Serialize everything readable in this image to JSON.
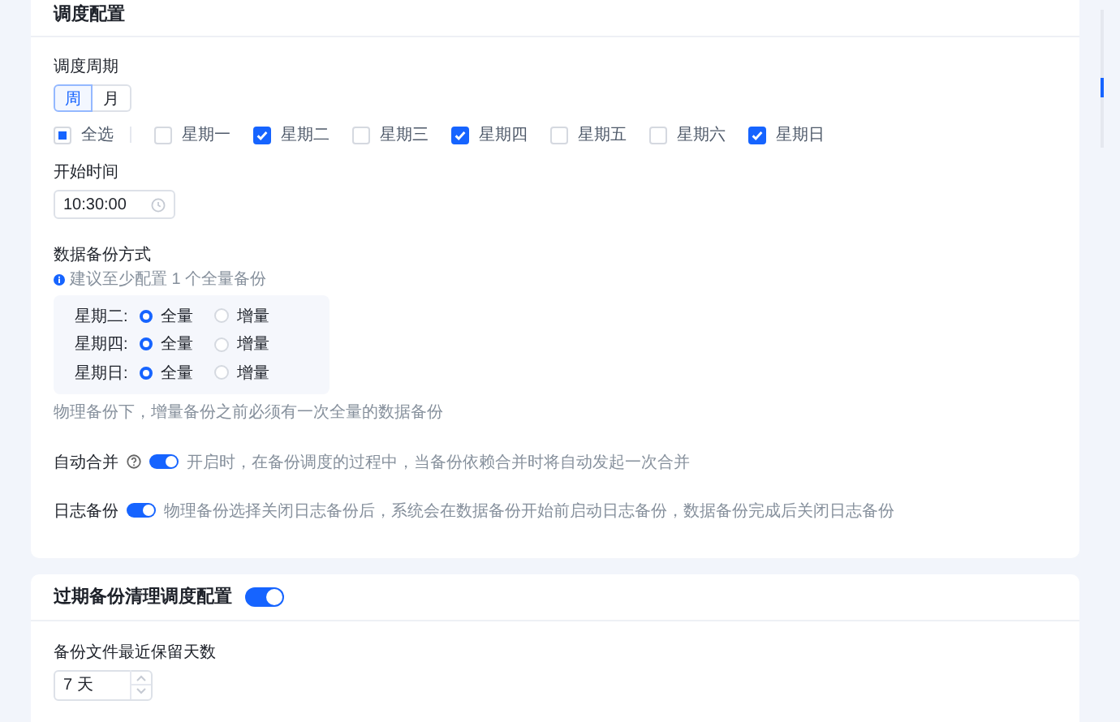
{
  "schedule": {
    "title": "调度配置",
    "period": {
      "label": "调度周期",
      "options": [
        {
          "label": "周",
          "selected": true
        },
        {
          "label": "月",
          "selected": false
        }
      ]
    },
    "select_all": {
      "label": "全选",
      "indeterminate": true
    },
    "days": [
      {
        "label": "星期一",
        "checked": false
      },
      {
        "label": "星期二",
        "checked": true
      },
      {
        "label": "星期三",
        "checked": false
      },
      {
        "label": "星期四",
        "checked": true
      },
      {
        "label": "星期五",
        "checked": false
      },
      {
        "label": "星期六",
        "checked": false
      },
      {
        "label": "星期日",
        "checked": true
      }
    ],
    "start_time": {
      "label": "开始时间",
      "value": "10:30:00"
    },
    "backup_mode": {
      "label": "数据备份方式",
      "info": "建议至少配置 1 个全量备份",
      "rows": [
        {
          "day": "星期二:",
          "options": [
            {
              "label": "全量",
              "selected": true
            },
            {
              "label": "增量",
              "selected": false
            }
          ]
        },
        {
          "day": "星期四:",
          "options": [
            {
              "label": "全量",
              "selected": true
            },
            {
              "label": "增量",
              "selected": false
            }
          ]
        },
        {
          "day": "星期日:",
          "options": [
            {
              "label": "全量",
              "selected": true
            },
            {
              "label": "增量",
              "selected": false
            }
          ]
        }
      ],
      "note": "物理备份下，增量备份之前必须有一次全量的数据备份"
    },
    "switches": [
      {
        "label": "自动合并",
        "help": true,
        "on": true,
        "description": "开启时，在备份调度的过程中，当备份依赖合并时将自动发起一次合并"
      },
      {
        "label": "日志备份",
        "help": false,
        "on": true,
        "description": "物理备份选择关闭日志备份后，系统会在数据备份开始前启动日志备份，数据备份完成后关闭日志备份"
      }
    ]
  },
  "expiry": {
    "title": "过期备份清理调度配置",
    "on": true,
    "retention_label": "备份文件最近保留天数",
    "value": "7 天"
  }
}
